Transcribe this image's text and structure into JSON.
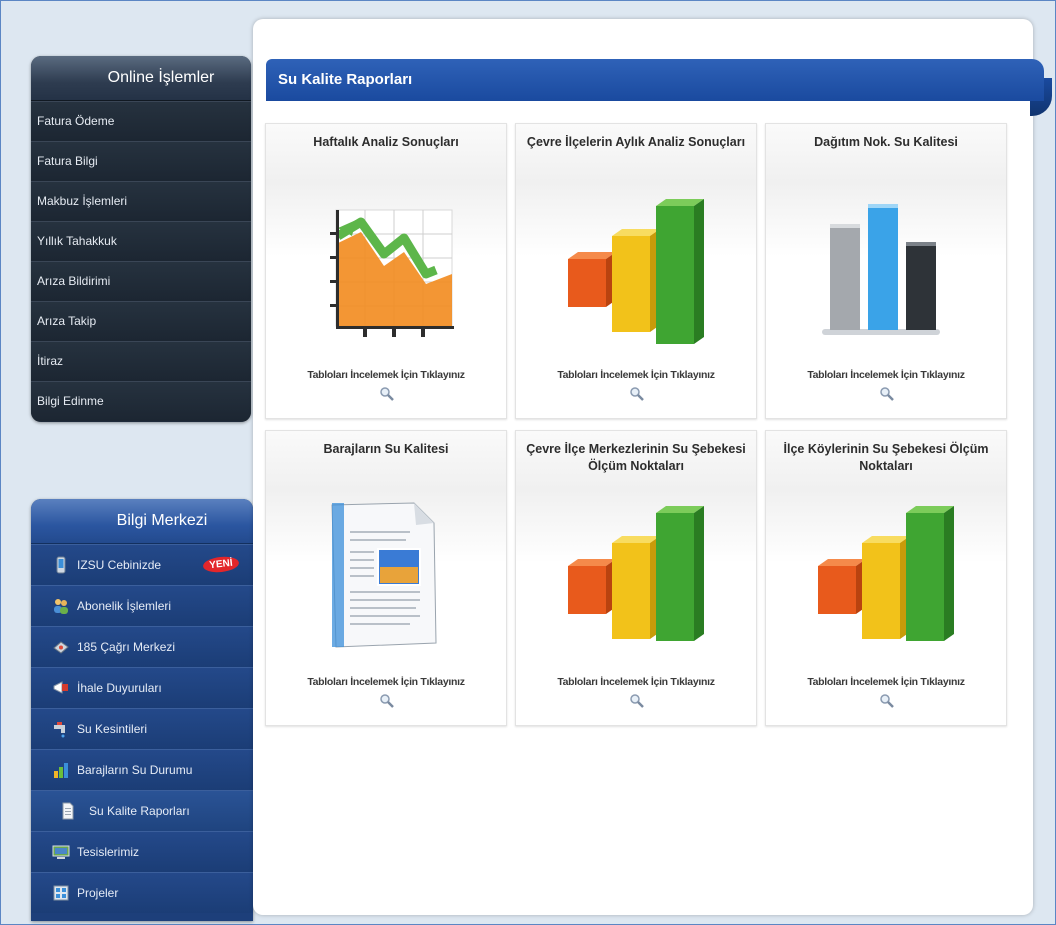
{
  "sidebar": {
    "online": {
      "title": "Online İşlemler",
      "items": [
        "Fatura Ödeme",
        "Fatura Bilgi",
        "Makbuz İşlemleri",
        "Yıllık Tahakkuk",
        "Arıza Bildirimi",
        "Arıza Takip",
        "İtiraz",
        "Bilgi Edinme"
      ]
    },
    "bilgi": {
      "title": "Bilgi Merkezi",
      "items": [
        {
          "label": "IZSU Cebinizde",
          "icon": "mobile-phone-icon",
          "badge": "YENİ"
        },
        {
          "label": "Abonelik İşlemleri",
          "icon": "users-icon"
        },
        {
          "label": "185 Çağrı Merkezi",
          "icon": "phone-icon"
        },
        {
          "label": "İhale Duyuruları",
          "icon": "megaphone-icon"
        },
        {
          "label": "Su Kesintileri",
          "icon": "water-tap-icon"
        },
        {
          "label": "Barajların Su Durumu",
          "icon": "bar-chart-icon"
        },
        {
          "label": "Su Kalite Raporları",
          "icon": "document-icon",
          "indent": true
        },
        {
          "label": "Tesislerimiz",
          "icon": "facility-icon"
        },
        {
          "label": "Projeler",
          "icon": "projects-icon"
        }
      ]
    }
  },
  "main": {
    "title": "Su Kalite Raporları",
    "link_text": "Tabloları İncelemek İçin Tıklayınız",
    "cards": [
      {
        "title": "Haftalık Analiz Sonuçları",
        "art": "line-chart-icon"
      },
      {
        "title": "Çevre İlçelerin Aylık Analiz Sonuçları",
        "art": "bar-chart-color-icon"
      },
      {
        "title": "Dağıtım Nok. Su Kalitesi",
        "art": "bar-chart-gray-icon"
      },
      {
        "title": "Barajların Su Kalitesi",
        "art": "document-report-icon"
      },
      {
        "title": "Çevre İlçe Merkezlerinin Su Şebekesi Ölçüm Noktaları",
        "art": "bar-chart-color-icon"
      },
      {
        "title": "İlçe Köylerinin Su Şebekesi Ölçüm Noktaları",
        "art": "bar-chart-color-icon"
      }
    ]
  },
  "colors": {
    "accent_blue": "#1a4a9f",
    "sidebar_dark": "#1e2a3a",
    "sidebar_blue": "#1d3f7a",
    "badge_red": "#e3262a"
  }
}
